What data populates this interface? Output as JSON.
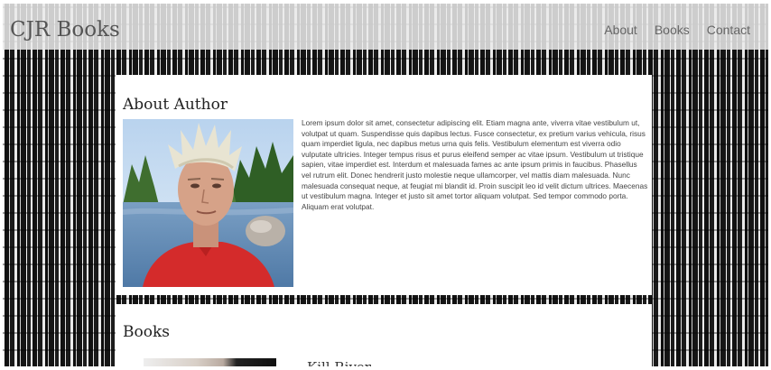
{
  "header": {
    "brand": "CJR Books",
    "nav": [
      {
        "label": "About"
      },
      {
        "label": "Books"
      },
      {
        "label": "Contact"
      }
    ]
  },
  "about": {
    "title": "About Author",
    "photo": "author-photo",
    "bio": "Lorem ipsum dolor sit amet, consectetur adipiscing elit. Etiam magna ante, viverra vitae vestibulum ut, volutpat ut quam. Suspendisse quis dapibus lectus. Fusce consectetur, ex pretium varius vehicula, risus quam imperdiet ligula, nec dapibus metus urna quis felis. Vestibulum elementum est viverra odio vulputate ultricies. Integer tempus risus et purus eleifend semper ac vitae ipsum. Vestibulum ut tristique sapien, vitae imperdiet est. Interdum et malesuada fames ac ante ipsum primis in faucibus. Phasellus vel rutrum elit. Donec hendrerit justo molestie neque ullamcorper, vel mattis diam malesuada. Nunc malesuada consequat neque, at feugiat mi blandit id. Proin suscipit leo id velit dictum ultrices. Maecenas ut vestibulum magna. Integer et justo sit amet tortor aliquam volutpat. Sed tempor commodo porta. Aliquam erat volutpat."
  },
  "books": {
    "title": "Books",
    "items": [
      {
        "title": "Kill River"
      }
    ]
  }
}
